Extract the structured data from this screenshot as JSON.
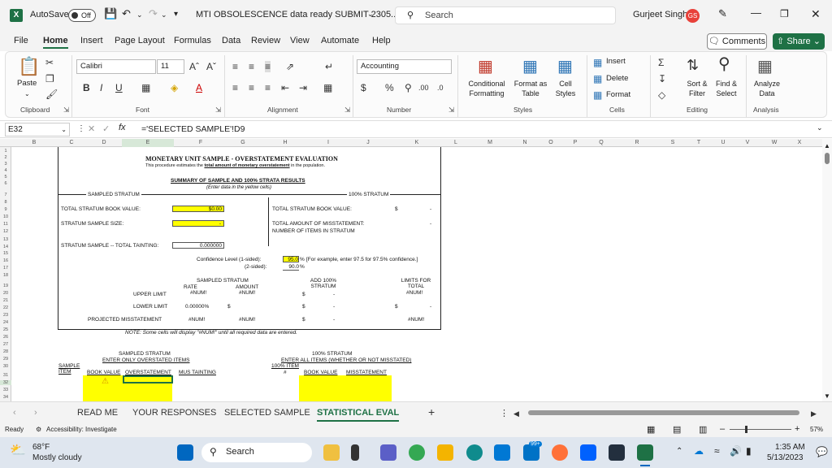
{
  "titlebar": {
    "autosave_label": "AutoSave",
    "autosave_state": "Off",
    "file_title": "MTI OBSOLESCENCE data ready SUBMIT 2305...",
    "search_placeholder": "Search",
    "user_name": "Gurjeet Singh",
    "user_initials": "GS"
  },
  "menu": {
    "items": [
      "File",
      "Home",
      "Insert",
      "Page Layout",
      "Formulas",
      "Data",
      "Review",
      "View",
      "Automate",
      "Help"
    ],
    "comments_label": "Comments",
    "share_label": "Share"
  },
  "ribbon": {
    "paste_label": "Paste",
    "clipboard_label": "Clipboard",
    "font_name": "Calibri",
    "font_size": "11",
    "font_label": "Font",
    "alignment_label": "Alignment",
    "number_format": "Accounting",
    "number_label": "Number",
    "conditional_formatting": "Conditional Formatting",
    "format_as_table": "Format as Table",
    "cell_styles": "Cell Styles",
    "styles_label": "Styles",
    "insert_label": "Insert",
    "delete_label": "Delete",
    "format_label": "Format",
    "cells_label": "Cells",
    "sort_filter": "Sort & Filter",
    "find_select": "Find & Select",
    "editing_label": "Editing",
    "analyze_data": "Analyze Data",
    "analysis_label": "Analysis"
  },
  "formula_bar": {
    "cell_ref": "E32",
    "formula": "='SELECTED SAMPLE'!D9"
  },
  "columns": [
    "B",
    "C",
    "D",
    "E",
    "F",
    "G",
    "H",
    "I",
    "J",
    "K",
    "L",
    "M",
    "N",
    "O",
    "P",
    "Q",
    "R",
    "S",
    "T",
    "U",
    "V",
    "W",
    "X"
  ],
  "rows": [
    "1",
    "2",
    "3",
    "4",
    "5",
    "6",
    "7",
    "8",
    "9",
    "10",
    "11",
    "12",
    "13",
    "14",
    "15",
    "16",
    "17",
    "18",
    "19",
    "20",
    "21",
    "22",
    "23",
    "24",
    "25",
    "26",
    "27",
    "28",
    "29",
    "30",
    "31",
    "32",
    "33",
    "34"
  ],
  "sheet": {
    "title": "MONETARY UNIT SAMPLE - OVERSTATEMENT EVALUATION",
    "subtitle_pre": "This procedure estimates the ",
    "subtitle_ul": "total amount of monetary overstatement",
    "subtitle_post": " in the population.",
    "summary_title": "SUMMARY OF SAMPLE AND 100% STRATA RESULTS",
    "summary_sub": "(Enter data in the yellow cells)",
    "sampled_stratum": "SAMPLED STRATUM",
    "strata_100": "100% STRATUM",
    "total_book_value": "TOTAL STRATUM BOOK VALUE:",
    "book_value_val": "$0.00",
    "sample_size": "STRATUM SAMPLE SIZE:",
    "sample_size_val": "-",
    "total_tainting": "STRATUM SAMPLE -- TOTAL TAINTING:",
    "tainting_val": "0.000000",
    "total_100_book": "TOTAL STRATUM BOOK VALUE:",
    "total_100_book_cur": "$",
    "total_100_book_val": "-",
    "total_misstatement": "TOTAL AMOUNT OF MISSTATEMENT:",
    "total_misstatement_val": "-",
    "num_items_misstated": "NUMBER OF ITEMS IN STRATUM",
    "conf_upper": "Confidence Level (1-sided):",
    "conf_upper_val": "95.0",
    "conf_pct": "%",
    "conf_note": "[For example, enter 97.5 for 97.5% confidence.]",
    "conf_lower": "(2-sided):",
    "conf_lower_val": "90.0",
    "conf_lower_pct": "%",
    "col_sampled_stratum": "SAMPLED STRATUM",
    "col_rate": "RATE",
    "col_amount": "AMOUNT",
    "col_add_100": "ADD 100% STRATUM",
    "col_limits": "LIMITS FOR TOTAL",
    "num_err": "#NUM!",
    "upper_limit": "UPPER LIMIT",
    "upper_cur": "$",
    "upper_dash": "-",
    "lower_limit": "LOWER LIMIT",
    "lower_rate": "0.00000%",
    "lower_cur": "$",
    "lower_cur2": "$",
    "lower_dash": "-",
    "lower_cur3": "$",
    "lower_dash3": "-",
    "projected": "PROJECTED MISSTATEMENT",
    "proj_cur": "$",
    "proj_dash": "-",
    "note": "NOTE: Some cells will display \"#NUM!\" until all required data are entered.",
    "bottom_sampled": "SAMPLED STRATUM",
    "bottom_sampled_sub": "ENTER ONLY OVERSTATED ITEMS",
    "bottom_100": "100% STRATUM",
    "bottom_100_sub": "ENTER ALL ITEMS (WHETHER OR NOT MISSTATED)",
    "hdr_sample_item": "SAMPLE ITEM",
    "hdr_book_value": "BOOK VALUE",
    "hdr_overstatement": "OVERSTATEMENT",
    "hdr_mus_tainting": "MUS TAINTING",
    "hdr_100_item": "100% ITEM",
    "hdr_100_item_num": "#",
    "hdr_100_book": "BOOK VALUE",
    "hdr_100_misstatement": "MISSTATEMENT"
  },
  "tabs": [
    "READ ME",
    "YOUR RESPONSES",
    "SELECTED SAMPLE",
    "STATISTICAL EVAL"
  ],
  "status": {
    "ready": "Ready",
    "accessibility": "Accessibility: Investigate",
    "zoom": "57%"
  },
  "taskbar": {
    "weather_temp": "68°F",
    "weather_desc": "Mostly cloudy",
    "search_label": "Search",
    "badge": "99+",
    "time": "1:35 AM",
    "date": "5/13/2023"
  },
  "colors": {
    "accent": "#1e7145",
    "yellow": "#ffff00",
    "avatar": "#e8413a"
  }
}
